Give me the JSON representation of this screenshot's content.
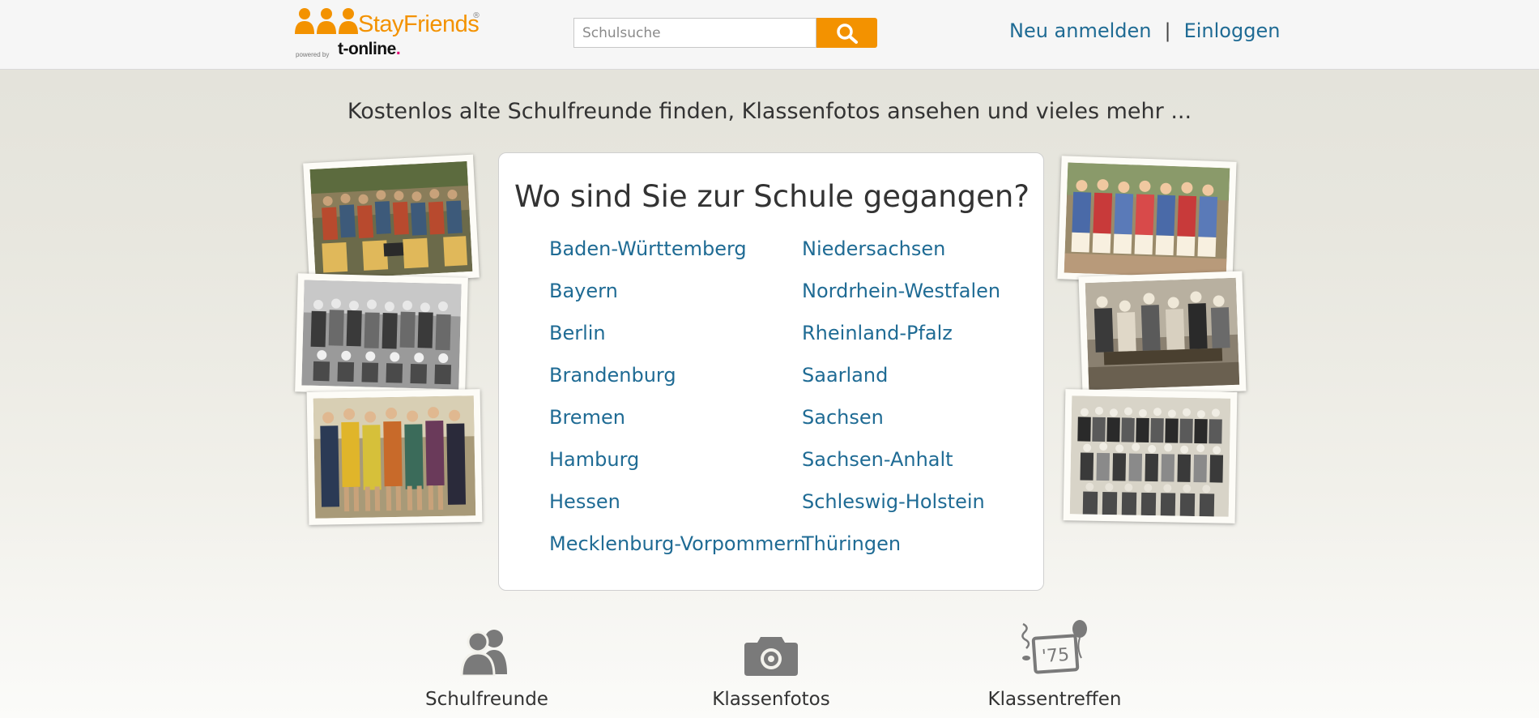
{
  "header": {
    "logo_brand": "StayFriends",
    "logo_registered": "®",
    "logo_powered_by": "powered by",
    "logo_partner": "t-online",
    "logo_partner_dot": ".",
    "search_placeholder": "Schulsuche",
    "register_label": "Neu anmelden",
    "separator": "|",
    "login_label": "Einloggen"
  },
  "tagline": "Kostenlos alte Schulfreunde finden, Klassenfotos ansehen und vieles mehr ...",
  "card": {
    "title": "Wo sind Sie zur Schule gegangen?",
    "states_left": [
      "Baden-Württemberg",
      "Bayern",
      "Berlin",
      "Brandenburg",
      "Bremen",
      "Hamburg",
      "Hessen",
      "Mecklenburg-Vorpommern"
    ],
    "states_right": [
      "Niedersachsen",
      "Nordrhein-Westfalen",
      "Rheinland-Pfalz",
      "Saarland",
      "Sachsen",
      "Sachsen-Anhalt",
      "Schleswig-Holstein",
      "Thüringen"
    ]
  },
  "features": [
    {
      "label": "Schulfreunde",
      "icon": "people-icon"
    },
    {
      "label": "Klassenfotos",
      "icon": "camera-icon"
    },
    {
      "label": "Klassentreffen",
      "icon": "reunion-75-icon"
    }
  ],
  "colors": {
    "brand_orange": "#f39200",
    "link_blue": "#1f6b94",
    "icon_gray": "#7a7a7a"
  }
}
